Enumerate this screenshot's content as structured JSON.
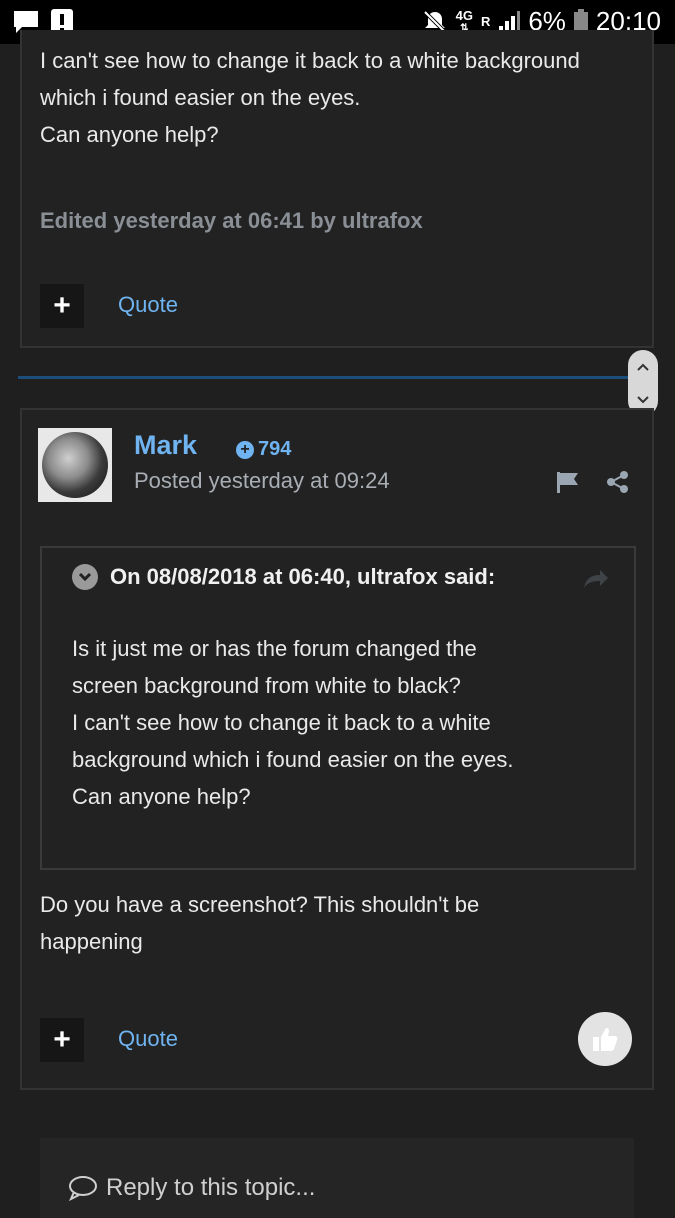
{
  "status_bar": {
    "network_type": "4G",
    "roaming": "R",
    "battery": "6%",
    "time": "20:10"
  },
  "post1": {
    "text_lines": [
      "I can't see how to change it back to a white background",
      "which i found easier on the eyes.",
      "Can anyone help?"
    ],
    "edited_note": "Edited yesterday at 06:41 by ultrafox",
    "quote_label": "Quote",
    "plus_label": "+"
  },
  "post2": {
    "author": "Mark",
    "reputation": "794",
    "posted": "Posted yesterday at 09:24",
    "quote_header": "On 08/08/2018 at 06:40, ultrafox said:",
    "quote_lines": [
      "Is it just me or has the forum changed the",
      "screen background from white to black?",
      "I can't see how to change it back to a white",
      "background which i found easier on the eyes.",
      "Can anyone help?"
    ],
    "reply_lines": [
      "Do you have a screenshot? This shouldn't be",
      "happening"
    ],
    "quote_label": "Quote",
    "plus_label": "+"
  },
  "reply_box": {
    "placeholder": "Reply to this topic..."
  },
  "colors": {
    "accent": "#6fb3f0",
    "background": "#1f1f1f",
    "divider": "#1c4e7c"
  }
}
